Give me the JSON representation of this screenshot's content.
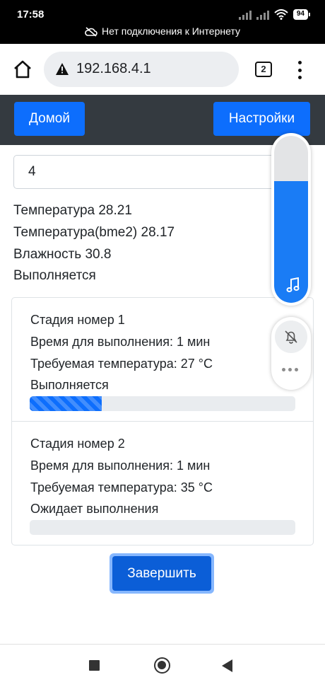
{
  "status_bar": {
    "time": "17:58",
    "battery": "94",
    "network_notice": "Нет подключения к Интернету",
    "icons": [
      "signal-icon",
      "signal-x-icon",
      "wifi-icon",
      "battery-icon",
      "cloud-off-icon"
    ]
  },
  "browser": {
    "url": "192.168.4.1",
    "tab_count": "2",
    "icons": [
      "home-icon",
      "warning-icon",
      "tabs-icon",
      "more-vert-icon"
    ]
  },
  "navbar": {
    "home_label": "Домой",
    "settings_label": "Настройки"
  },
  "form": {
    "number_value": "4"
  },
  "readings": {
    "temperature": "Температура 28.21",
    "temperature_bme2": "Температура(bme2) 28.17",
    "humidity": "Влажность 30.8",
    "state": "Выполняется"
  },
  "stages": [
    {
      "title": "Стадия номер 1",
      "duration": "Время для выполнения: 1 мин",
      "target_temp": "Требуемая температура: 27 °C",
      "status": "Выполняется",
      "progress_percent": 27
    },
    {
      "title": "Стадия номер 2",
      "duration": "Время для выполнения: 1 мин",
      "target_temp": "Требуемая температура: 35 °C",
      "status": "Ожидает выполнения",
      "progress_percent": 0
    }
  ],
  "finish_label": "Завершить",
  "volume_overlay": {
    "level_percent": 73,
    "icons": [
      "music-note-icon",
      "bell-off-icon",
      "more-horiz-icon"
    ]
  },
  "colors": {
    "primary": "#0d6efd",
    "navbar_bg": "#343a40",
    "volume_fill": "#1a7cf5"
  }
}
